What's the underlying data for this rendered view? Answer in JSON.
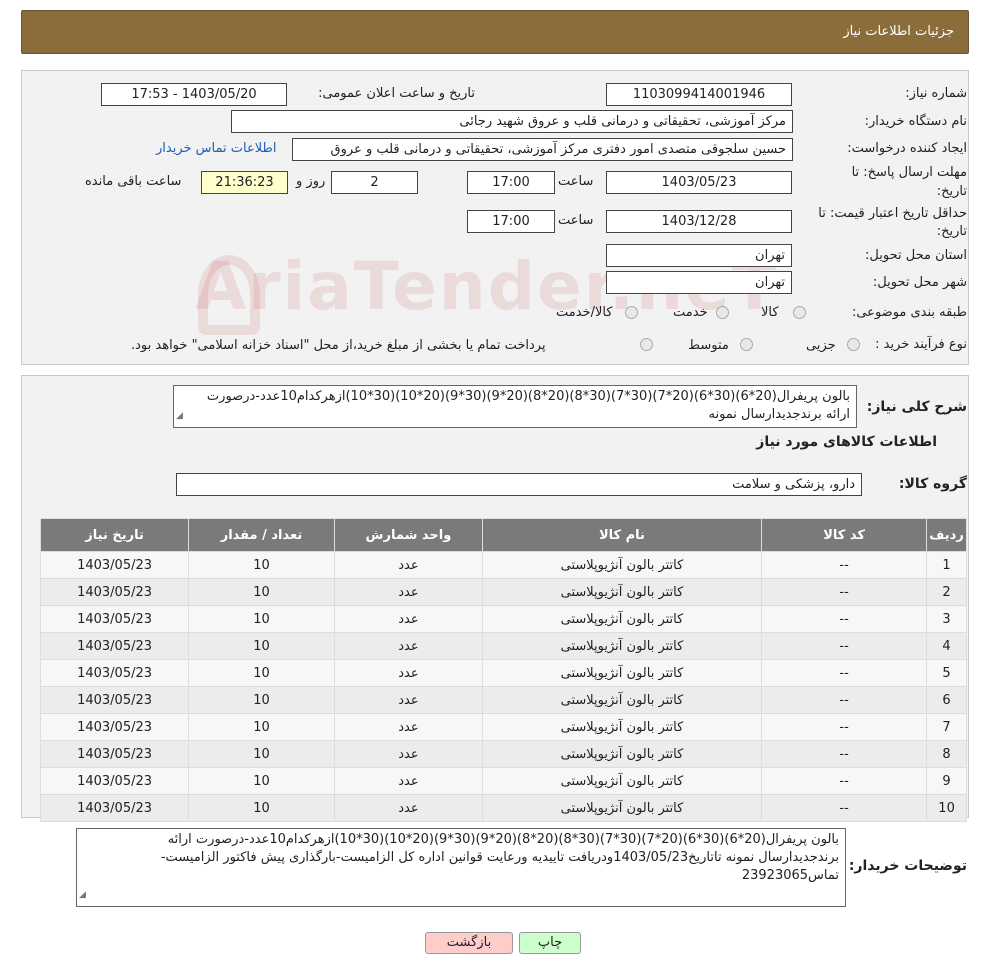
{
  "header": {
    "title": "جزئیات اطلاعات نیاز"
  },
  "form": {
    "need_number_label": "شماره نیاز:",
    "need_number": "1103099414001946",
    "announce_label": "تاریخ و ساعت اعلان عمومی:",
    "announce_value": "1403/05/20 - 17:53",
    "buyer_org_label": "نام دستگاه خریدار:",
    "buyer_org": "مرکز آموزشی، تحقیقاتی و درمانی قلب و عروق شهید رجائی",
    "creator_label": "ایجاد کننده درخواست:",
    "creator": "حسین سلجوقی متصدی امور دفتری مرکز آموزشی، تحقیقاتی و درمانی قلب و عروق",
    "contact_link": "اطلاعات تماس خریدار",
    "deadline_label_1": "مهلت ارسال پاسخ: تا",
    "deadline_label_2": "تاریخ:",
    "deadline_date": "1403/05/23",
    "time_label": "ساعت",
    "deadline_time": "17:00",
    "days_value": "2",
    "days_label": "روز و",
    "remaining_value": "21:36:23",
    "remaining_label": "ساعت باقی مانده",
    "validity_label_1": "حداقل تاریخ اعتبار قیمت: تا",
    "validity_label_2": "تاریخ:",
    "validity_date": "1403/12/28",
    "validity_time": "17:00",
    "province_label": "استان محل تحویل:",
    "province": "تهران",
    "city_label": "شهر محل تحویل:",
    "city": "تهران",
    "category_label": "طبقه بندی موضوعی:",
    "category_options": [
      "کالا",
      "خدمت",
      "کالا/خدمت"
    ],
    "process_label": "نوع فرآیند خرید :",
    "process_options": [
      "جزیی",
      "متوسط"
    ],
    "process_note": "پرداخت تمام یا بخشی از مبلغ خرید،از محل \"اسناد خزانه اسلامی\" خواهد بود."
  },
  "description": {
    "label": "شرح کلی نیاز:",
    "text": "بالون پریفرال(20*6)(30*6)(20*7)(30*7)(30*8)(20*8)(20*9)(30*9)(20*10)(30*10)ازهرکدام10عدد-درصورت ارائه برندجدیدارسال نمونه"
  },
  "goods": {
    "section_title": "اطلاعات کالاهای مورد نیاز",
    "group_label": "گروه کالا:",
    "group_value": "دارو، پزشکی و سلامت"
  },
  "table": {
    "headers": [
      "ردیف",
      "کد کالا",
      "نام کالا",
      "واحد شمارش",
      "تعداد / مقدار",
      "تاریخ نیاز"
    ],
    "rows": [
      [
        "1",
        "--",
        "کاتتر بالون آنژیوپلاستی",
        "عدد",
        "10",
        "1403/05/23"
      ],
      [
        "2",
        "--",
        "کاتتر بالون آنژیوپلاستی",
        "عدد",
        "10",
        "1403/05/23"
      ],
      [
        "3",
        "--",
        "کاتتر بالون آنژیوپلاستی",
        "عدد",
        "10",
        "1403/05/23"
      ],
      [
        "4",
        "--",
        "کاتتر بالون آنژیوپلاستی",
        "عدد",
        "10",
        "1403/05/23"
      ],
      [
        "5",
        "--",
        "کاتتر بالون آنژیوپلاستی",
        "عدد",
        "10",
        "1403/05/23"
      ],
      [
        "6",
        "--",
        "کاتتر بالون آنژیوپلاستی",
        "عدد",
        "10",
        "1403/05/23"
      ],
      [
        "7",
        "--",
        "کاتتر بالون آنژیوپلاستی",
        "عدد",
        "10",
        "1403/05/23"
      ],
      [
        "8",
        "--",
        "کاتتر بالون آنژیوپلاستی",
        "عدد",
        "10",
        "1403/05/23"
      ],
      [
        "9",
        "--",
        "کاتتر بالون آنژیوپلاستی",
        "عدد",
        "10",
        "1403/05/23"
      ],
      [
        "10",
        "--",
        "کاتتر بالون آنژیوپلاستی",
        "عدد",
        "10",
        "1403/05/23"
      ]
    ]
  },
  "buyer_notes": {
    "label": "توضیحات خریدار:",
    "text": "بالون پریفرال(20*6)(30*6)(20*7)(30*7)(30*8)(20*8)(20*9)(30*9)(20*10)(30*10)ازهرکدام10عدد-درصورت ارائه برندجدیدارسال نمونه تاتاریخ1403/05/23ودریافت تاییدیه ورعایت قوانین اداره کل الزامیست-بارگذاری پیش فاکتور الزامیست-تماس23923065"
  },
  "buttons": {
    "print": "چاپ",
    "back": "بازگشت"
  },
  "watermark": "AriaTender.neT"
}
